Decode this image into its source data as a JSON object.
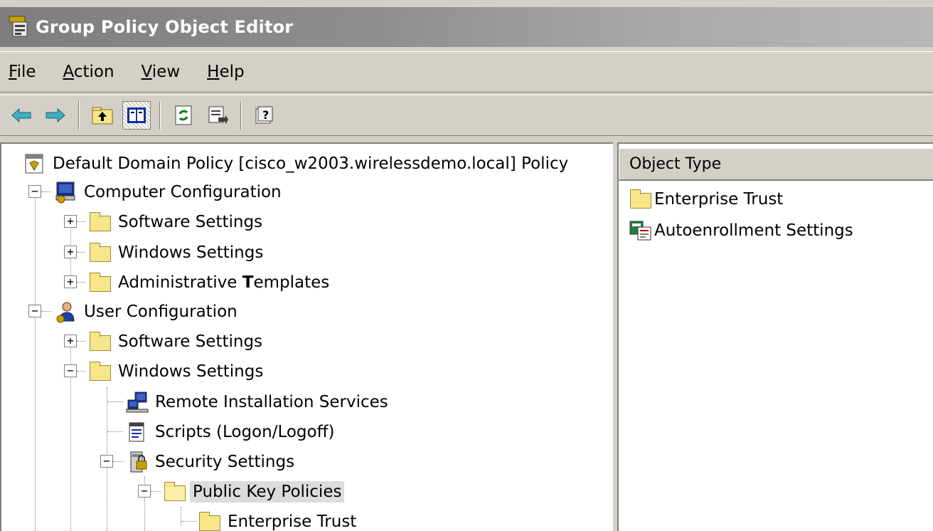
{
  "window": {
    "title": "Group Policy Object Editor"
  },
  "menu": [
    {
      "accel": "F",
      "rest": "ile"
    },
    {
      "accel": "A",
      "rest": "ction"
    },
    {
      "accel": "V",
      "rest": "iew"
    },
    {
      "accel": "H",
      "rest": "elp"
    }
  ],
  "toolbar": [
    "back-icon",
    "forward-icon",
    "up-folder-icon",
    "show-hide-tree-icon",
    "refresh-icon",
    "export-list-icon",
    "help-icon"
  ],
  "tree": {
    "root": "Default Domain Policy [cisco_w2003.wirelessdemo.local] Policy",
    "computer_config": "Computer Configuration",
    "cc_software": "Software Settings",
    "cc_windows": "Windows Settings",
    "cc_admin_prefix": "Administrative ",
    "cc_admin_bold": "T",
    "cc_admin_suffix": "emplates",
    "user_config": "User Configuration",
    "uc_software": "Software Settings",
    "uc_windows": "Windows Settings",
    "remote_install": "Remote Installation Services",
    "scripts": "Scripts (Logon/Logoff)",
    "security": "Security Settings",
    "public_key": "Public Key Policies",
    "enterprise_trust": "Enterprise Trust"
  },
  "list": {
    "column_header": "Object Type",
    "items": [
      "Enterprise Trust",
      "Autoenrollment Settings"
    ]
  },
  "colors": {
    "titlebar": "#8e8e8e",
    "face": "#d4d0c8",
    "selection": "#dcdcdc"
  }
}
